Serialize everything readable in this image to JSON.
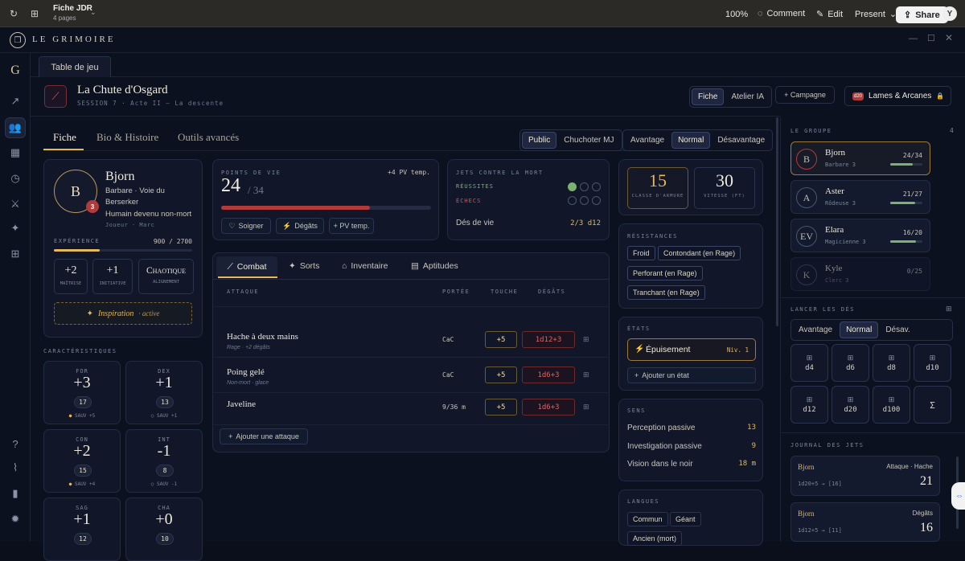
{
  "topbar": {
    "title": "Fiche JDR",
    "subtitle": "4 pages",
    "zoom": "100%",
    "comment": "Comment",
    "edit": "Edit",
    "present": "Present",
    "share": "Share",
    "avatar": "Y"
  },
  "app": {
    "logo": "LE GRIMOIRE",
    "rail_letter": "G",
    "tab": "Table de jeu"
  },
  "session": {
    "title": "La Chute d'Osgard",
    "subtitle": "SESSION 7 · Acte II — La descente",
    "mode_fiche": "Fiche",
    "mode_atelier": "Atelier IA",
    "campagne": "+ Campagne",
    "brand_badge": "d20",
    "brand": "Lames & Arcanes"
  },
  "tabs": {
    "fiche": "Fiche",
    "bio": "Bio & Histoire",
    "outils": "Outils avancés"
  },
  "visibility": {
    "public": "Public",
    "whisper": "Chuchoter MJ"
  },
  "advantage": {
    "adv": "Avantage",
    "normal": "Normal",
    "dis": "Désavantage"
  },
  "character": {
    "initial": "B",
    "level": "3",
    "name": "Bjorn",
    "class": "Barbare · Voie du Berserker",
    "race": "Humain devenu non-mort",
    "player": "Joueur · Marc",
    "xp_label": "EXPÉRIENCE",
    "xp": "900 / 2700",
    "xp_fraction": 0.33,
    "mastery": "+2",
    "mastery_lbl": "MAÎTRISE",
    "init": "+1",
    "init_lbl": "INITIATIVE",
    "align": "Chaotique",
    "align_lbl": "ALIGNEMENT",
    "inspiration": "Inspiration",
    "inspiration_state": "· active"
  },
  "abilities_label": "CARACTÉRISTIQUES",
  "abilities": [
    {
      "name": "FOR",
      "mod": "+3",
      "score": "17",
      "save": "SAUV +5",
      "prof": true
    },
    {
      "name": "DEX",
      "mod": "+1",
      "score": "13",
      "save": "SAUV +1",
      "prof": false
    },
    {
      "name": "CON",
      "mod": "+2",
      "score": "15",
      "save": "SAUV +4",
      "prof": true
    },
    {
      "name": "INT",
      "mod": "-1",
      "score": "8",
      "save": "SAUV -1",
      "prof": false
    },
    {
      "name": "SAG",
      "mod": "+1",
      "score": "12"
    },
    {
      "name": "CHA",
      "mod": "+0",
      "score": "10"
    }
  ],
  "hp": {
    "label": "POINTS DE VIE",
    "temp": "+4 PV temp.",
    "current": "24",
    "max": "/ 34",
    "fraction": 0.71,
    "heal": "Soigner",
    "damage": "Dégâts",
    "add_temp": "+ PV temp."
  },
  "death": {
    "label": "JETS CONTRE LA MORT",
    "success": "RÉUSSITES",
    "fail": "ÉCHECS",
    "success_count": 1,
    "fail_count": 0,
    "hit_dice_label": "Dés de vie",
    "hit_dice": "2/3 d12"
  },
  "defense": {
    "ac": "15",
    "ac_label": "CLASSE D'ARMURE",
    "speed": "30",
    "speed_label": "VITESSE (FT)"
  },
  "combat_tabs": {
    "combat": "Combat",
    "spells": "Sorts",
    "inventory": "Inventaire",
    "skills": "Aptitudes"
  },
  "attack_headers": {
    "attack": "ATTAQUE",
    "range": "PORTÉE",
    "hit": "TOUCHE",
    "dmg": "DÉGÂTS"
  },
  "attacks": [
    {
      "name": "Hache à deux mains",
      "sub": "Rage · +2 dégâts",
      "range": "CaC",
      "hit": "+5",
      "dmg": "1d12+3"
    },
    {
      "name": "Poing gelé",
      "sub": "Non-mort · glace",
      "range": "CaC",
      "hit": "+5",
      "dmg": "1d6+3"
    },
    {
      "name": "Javeline",
      "sub": "",
      "range": "9/36 m",
      "hit": "+5",
      "dmg": "1d6+3"
    }
  ],
  "add_attack": "Ajouter une attaque",
  "resistances": {
    "label": "RÉSISTANCES",
    "items": [
      "Froid",
      "Contondant (en Rage)",
      "Perforant (en Rage)",
      "Tranchant (en Rage)"
    ]
  },
  "states": {
    "label": "ÉTATS",
    "name": "Épuisement",
    "level": "Niv. 1",
    "add": "Ajouter un état"
  },
  "senses": {
    "label": "SENS",
    "items": [
      {
        "name": "Perception passive",
        "val": "13"
      },
      {
        "name": "Investigation passive",
        "val": "9"
      },
      {
        "name": "Vision dans le noir",
        "val": "18 m"
      }
    ]
  },
  "languages": {
    "label": "LANGUES",
    "items": [
      "Commun",
      "Géant",
      "Ancien (mort)"
    ]
  },
  "group": {
    "label": "LE GROUPE",
    "count": "4",
    "members": [
      {
        "initial": "B",
        "name": "Bjorn",
        "class": "Barbare 3",
        "hp": "24/34",
        "frac": 0.71
      },
      {
        "initial": "A",
        "name": "Aster",
        "class": "Rôdeuse 3",
        "hp": "21/27",
        "frac": 0.78
      },
      {
        "initial": "EV",
        "name": "Elara",
        "class": "Magicienne 3",
        "hp": "16/20",
        "frac": 0.8
      },
      {
        "initial": "K",
        "name": "Kyle",
        "class": "Clerc 3",
        "hp": "0/25",
        "frac": 0
      }
    ]
  },
  "dice": {
    "label": "LANCER LES DÉS",
    "adv": "Avantage",
    "normal": "Normal",
    "dis": "Désav.",
    "list": [
      "d4",
      "d6",
      "d8",
      "d10",
      "d12",
      "d20",
      "d100",
      "Σ"
    ]
  },
  "log": {
    "label": "JOURNAL DES JETS",
    "entries": [
      {
        "who": "Bjorn",
        "what": "Attaque · Hache",
        "formula": "1d20+5 → [16]",
        "total": "21"
      },
      {
        "who": "Bjorn",
        "what": "Dégâts",
        "formula": "1d12+5 → [11]",
        "total": "16"
      }
    ]
  },
  "colors": {
    "accent": "#e5b85c",
    "danger": "#d9534f",
    "bg": "#0c1120"
  }
}
